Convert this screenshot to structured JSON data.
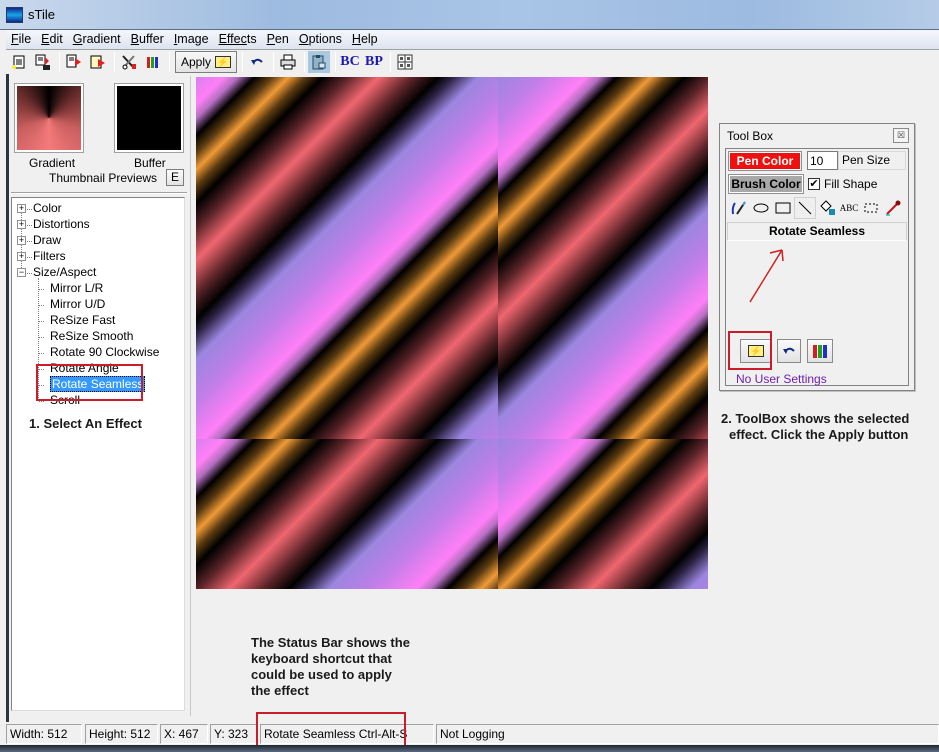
{
  "window": {
    "title": "sTile"
  },
  "menu": [
    {
      "key": "F",
      "rest": "ile",
      "label": "File"
    },
    {
      "key": "E",
      "rest": "dit",
      "label": "Edit"
    },
    {
      "key": "G",
      "rest": "radient",
      "label": "Gradient"
    },
    {
      "key": "B",
      "rest": "uffer",
      "label": "Buffer"
    },
    {
      "key": "I",
      "rest": "mage",
      "label": "Image"
    },
    {
      "key": "Effec",
      "rest": "ts",
      "label": "Effects"
    },
    {
      "key": "P",
      "rest": "en",
      "label": "Pen"
    },
    {
      "key": "O",
      "rest": "ptions",
      "label": "Options"
    },
    {
      "key": "H",
      "rest": "elp",
      "label": "Help"
    }
  ],
  "toolbar": {
    "apply_label": "Apply",
    "icons": [
      "new-icon",
      "save-icon",
      "copy-to-buffer-icon",
      "paste-from-buffer-icon",
      "tools-icon",
      "crayons-icon",
      "undo-icon",
      "print-icon",
      "clipboard-icon",
      "bc-icon",
      "bp-icon",
      "tile-grid-icon"
    ],
    "bc_text": "BC",
    "bp_text": "BP"
  },
  "thumbnails": {
    "gradient_label": "Gradient",
    "buffer_label": "Buffer",
    "caption": "Thumbnail Previews",
    "e_button": "E"
  },
  "effects_tree": {
    "categories": [
      {
        "label": "Color",
        "expanded": false
      },
      {
        "label": "Distortions",
        "expanded": false
      },
      {
        "label": "Draw",
        "expanded": false
      },
      {
        "label": "Filters",
        "expanded": false
      },
      {
        "label": "Size/Aspect",
        "expanded": true
      }
    ],
    "children": [
      "Mirror L/R",
      "Mirror U/D",
      "ReSize Fast",
      "ReSize Smooth",
      "Rotate 90 Clockwise",
      "Rotate Angle",
      "Rotate Seamless",
      "Scroll"
    ],
    "selected": "Rotate Seamless"
  },
  "annotations": {
    "step1": "1. Select An Effect",
    "step2_line1": "2. ToolBox shows the selected",
    "step2_line2": "effect.  Click the Apply button",
    "status_note": [
      "The Status Bar shows the",
      "keyboard shortcut that",
      "could be used to apply",
      "the effect"
    ]
  },
  "toolbox": {
    "title": "Tool Box",
    "pen_color_label": "Pen Color",
    "pen_color": "#ef1010",
    "pen_size_value": "10",
    "pen_size_label": "Pen Size",
    "brush_color_label": "Brush Color",
    "brush_color": "#a8a8a8",
    "fill_shape_label": "Fill Shape",
    "fill_shape_checked": true,
    "draw_tools": [
      "brush",
      "ellipse",
      "rectangle",
      "line",
      "fill",
      "text",
      "selection",
      "eyedropper"
    ],
    "active_tool": "line",
    "text_tool_glyph": "ABC",
    "effect_name": "Rotate Seamless",
    "no_settings": "No User Settings"
  },
  "statusbar": {
    "width": "Width: 512",
    "height": "Height: 512",
    "x": "X: 467",
    "y": "Y: 323",
    "shortcut": "Rotate Seamless Ctrl-Alt-S",
    "logging": "Not Logging"
  },
  "colors": {
    "highlight_red": "#cc1c2a",
    "selection_blue": "#3399ff",
    "no_settings_purple": "#6c1fb0"
  }
}
